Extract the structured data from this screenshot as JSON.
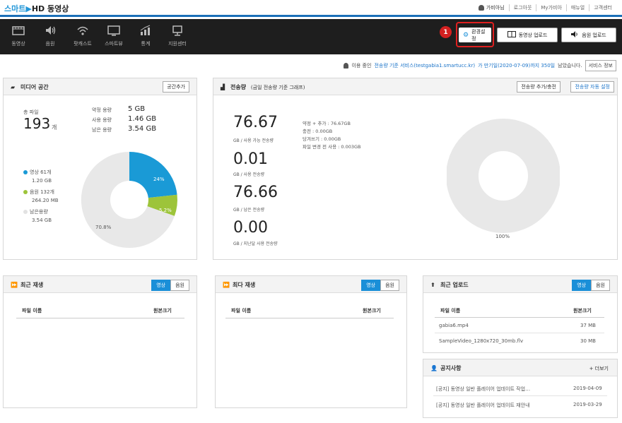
{
  "header": {
    "logo_part1": "스마트",
    "logo_part2": "HD 동영상",
    "links": [
      "가비아님",
      "로그아웃",
      "My가비아",
      "매뉴얼",
      "고객센터"
    ]
  },
  "nav": {
    "items": [
      "동영상",
      "음원",
      "팟캐스트",
      "스마트뷰",
      "통계",
      "지원센터"
    ],
    "env_settings": "환경설정",
    "upload_video": "동영상 업로드",
    "upload_audio": "음원 업로드",
    "badge": "1"
  },
  "service": {
    "text_pre": "이용 중인",
    "service_name": "전송량 기준 서비스(testgabia1.smartucc.kr)",
    "text_mid": "가 만기일(2020-07-09)까지 350일",
    "text_post": "남았습니다.",
    "info_button": "서비스 정보"
  },
  "media_space": {
    "title": "미디어 공간",
    "add_button": "공간추가",
    "total_files_label": "총 파일",
    "total_files_value": "193",
    "total_files_unit": "개",
    "contract_label": "약정 용량",
    "contract_value": "5 GB",
    "used_label": "사용 용량",
    "used_value": "1.46 GB",
    "remain_label": "남은 용량",
    "remain_value": "3.54 GB",
    "legend": [
      {
        "name": "영상 61개",
        "size": "1.20 GB",
        "color": "#1a9ad6"
      },
      {
        "name": "음원 132개",
        "size": "264.20 MB",
        "color": "#9dc43a"
      },
      {
        "name": "남은용량",
        "size": "3.54 GB",
        "color": "#e8e8e8"
      }
    ],
    "pie_labels": [
      "24%",
      "5.2%",
      "70.8%"
    ]
  },
  "transfer": {
    "title": "전송량",
    "subtitle": "(금일 전송량 기준 그래프)",
    "add_button": "전송량 추가/충전",
    "auto_button": "전송량 자동 설정",
    "stats": [
      {
        "value": "76.67",
        "label": "GB / 사용 가능 전송량"
      },
      {
        "value": "0.01",
        "label": "GB / 사용 전송량"
      },
      {
        "value": "76.66",
        "label": "GB / 남은 전송량"
      },
      {
        "value": "0.00",
        "label": "GB / 지난달 사용 전송량"
      }
    ],
    "details": [
      "약정 + 추가 : 76.67GB",
      "충전 : 0.00GB",
      "당겨쓰기 : 0.00GB",
      "파일 변경 전 사용 : 0.003GB"
    ],
    "pie_label": "100%"
  },
  "recent_play": {
    "title": "최근 재생",
    "tab_video": "영상",
    "tab_audio": "음원",
    "col_name": "파일 이름",
    "col_size": "원본크기"
  },
  "most_play": {
    "title": "최다 재생",
    "tab_video": "영상",
    "tab_audio": "음원",
    "col_name": "파일 이름",
    "col_size": "원본크기"
  },
  "recent_upload": {
    "title": "최근 업로드",
    "tab_video": "영상",
    "tab_audio": "음원",
    "col_name": "파일 이름",
    "col_size": "원본크기",
    "rows": [
      {
        "name": "gabia6.mp4",
        "size": "37 MB"
      },
      {
        "name": "SampleVideo_1280x720_30mb.flv",
        "size": "30 MB"
      }
    ]
  },
  "notice": {
    "title": "공지사항",
    "more": "+ 더보기",
    "rows": [
      {
        "title": "[공지] 동영상 일반 플레이어 업데이트 작업…",
        "date": "2019-04-09"
      },
      {
        "title": "[공지] 동영상 일반 플레이어 업데이트 재안내",
        "date": "2019-03-29"
      }
    ]
  }
}
